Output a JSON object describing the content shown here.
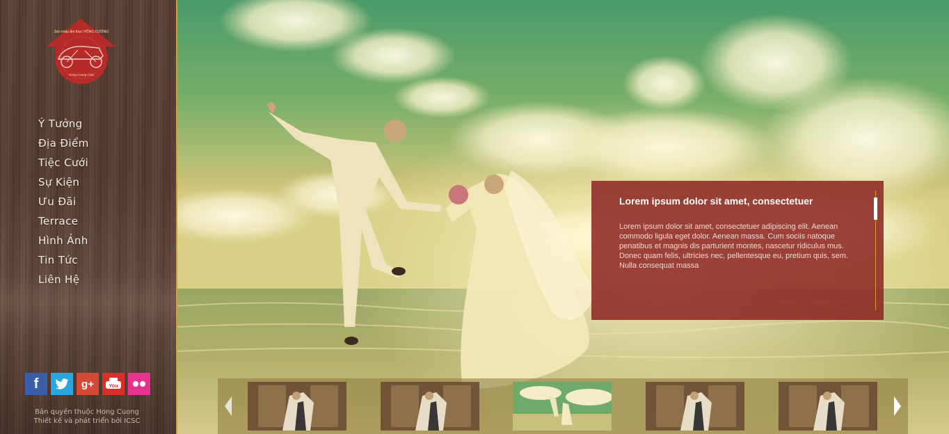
{
  "brand": {
    "logo_text": "Sân khấu ẩm thực HỒNG CƯỜNG",
    "logo_subtext": "Hong Cuong Club"
  },
  "nav": {
    "items": [
      {
        "label": "Ý Tưởng"
      },
      {
        "label": "Địa Điểm"
      },
      {
        "label": "Tiệc Cưới"
      },
      {
        "label": "Sự Kiện"
      },
      {
        "label": "Ưu Đãi"
      },
      {
        "label": "Terrace"
      },
      {
        "label": "Hình Ảnh"
      },
      {
        "label": "Tin Tức"
      },
      {
        "label": "Liên Hệ"
      }
    ]
  },
  "social": {
    "facebook": "f",
    "googleplus": "g+",
    "icons": [
      "facebook-icon",
      "twitter-icon",
      "google-plus-icon",
      "youtube-icon",
      "flickr-icon"
    ]
  },
  "footer": {
    "line1": "Bản quyền thuộc Hong Cuong",
    "line2": "Thiết kế và phát triển bởi ICSC"
  },
  "info_box": {
    "title": "Lorem ipsum dolor sit amet, consectetuer",
    "body": "Lorem ipsum dolor sit amet, consectetuer adipiscing elit. Aenean commodo ligula eget dolor. Aenean massa. Cum sociis natoque penatibus et magnis dis parturient montes, nascetur ridiculus mus. Donec quam felis, ultricies nec, pellentesque eu, pretium quis, sem. Nulla consequat massa"
  },
  "gallery": {
    "thumbnails": [
      {
        "name": "thumb-couple-1",
        "active": false
      },
      {
        "name": "thumb-couple-2",
        "active": false
      },
      {
        "name": "thumb-beach",
        "active": true
      },
      {
        "name": "thumb-couple-3",
        "active": false
      },
      {
        "name": "thumb-couple-4",
        "active": false
      }
    ]
  },
  "colors": {
    "sidebar_border": "#c9a531",
    "info_box_bg": "#8c2422",
    "accent_gold": "#d79c3b"
  }
}
